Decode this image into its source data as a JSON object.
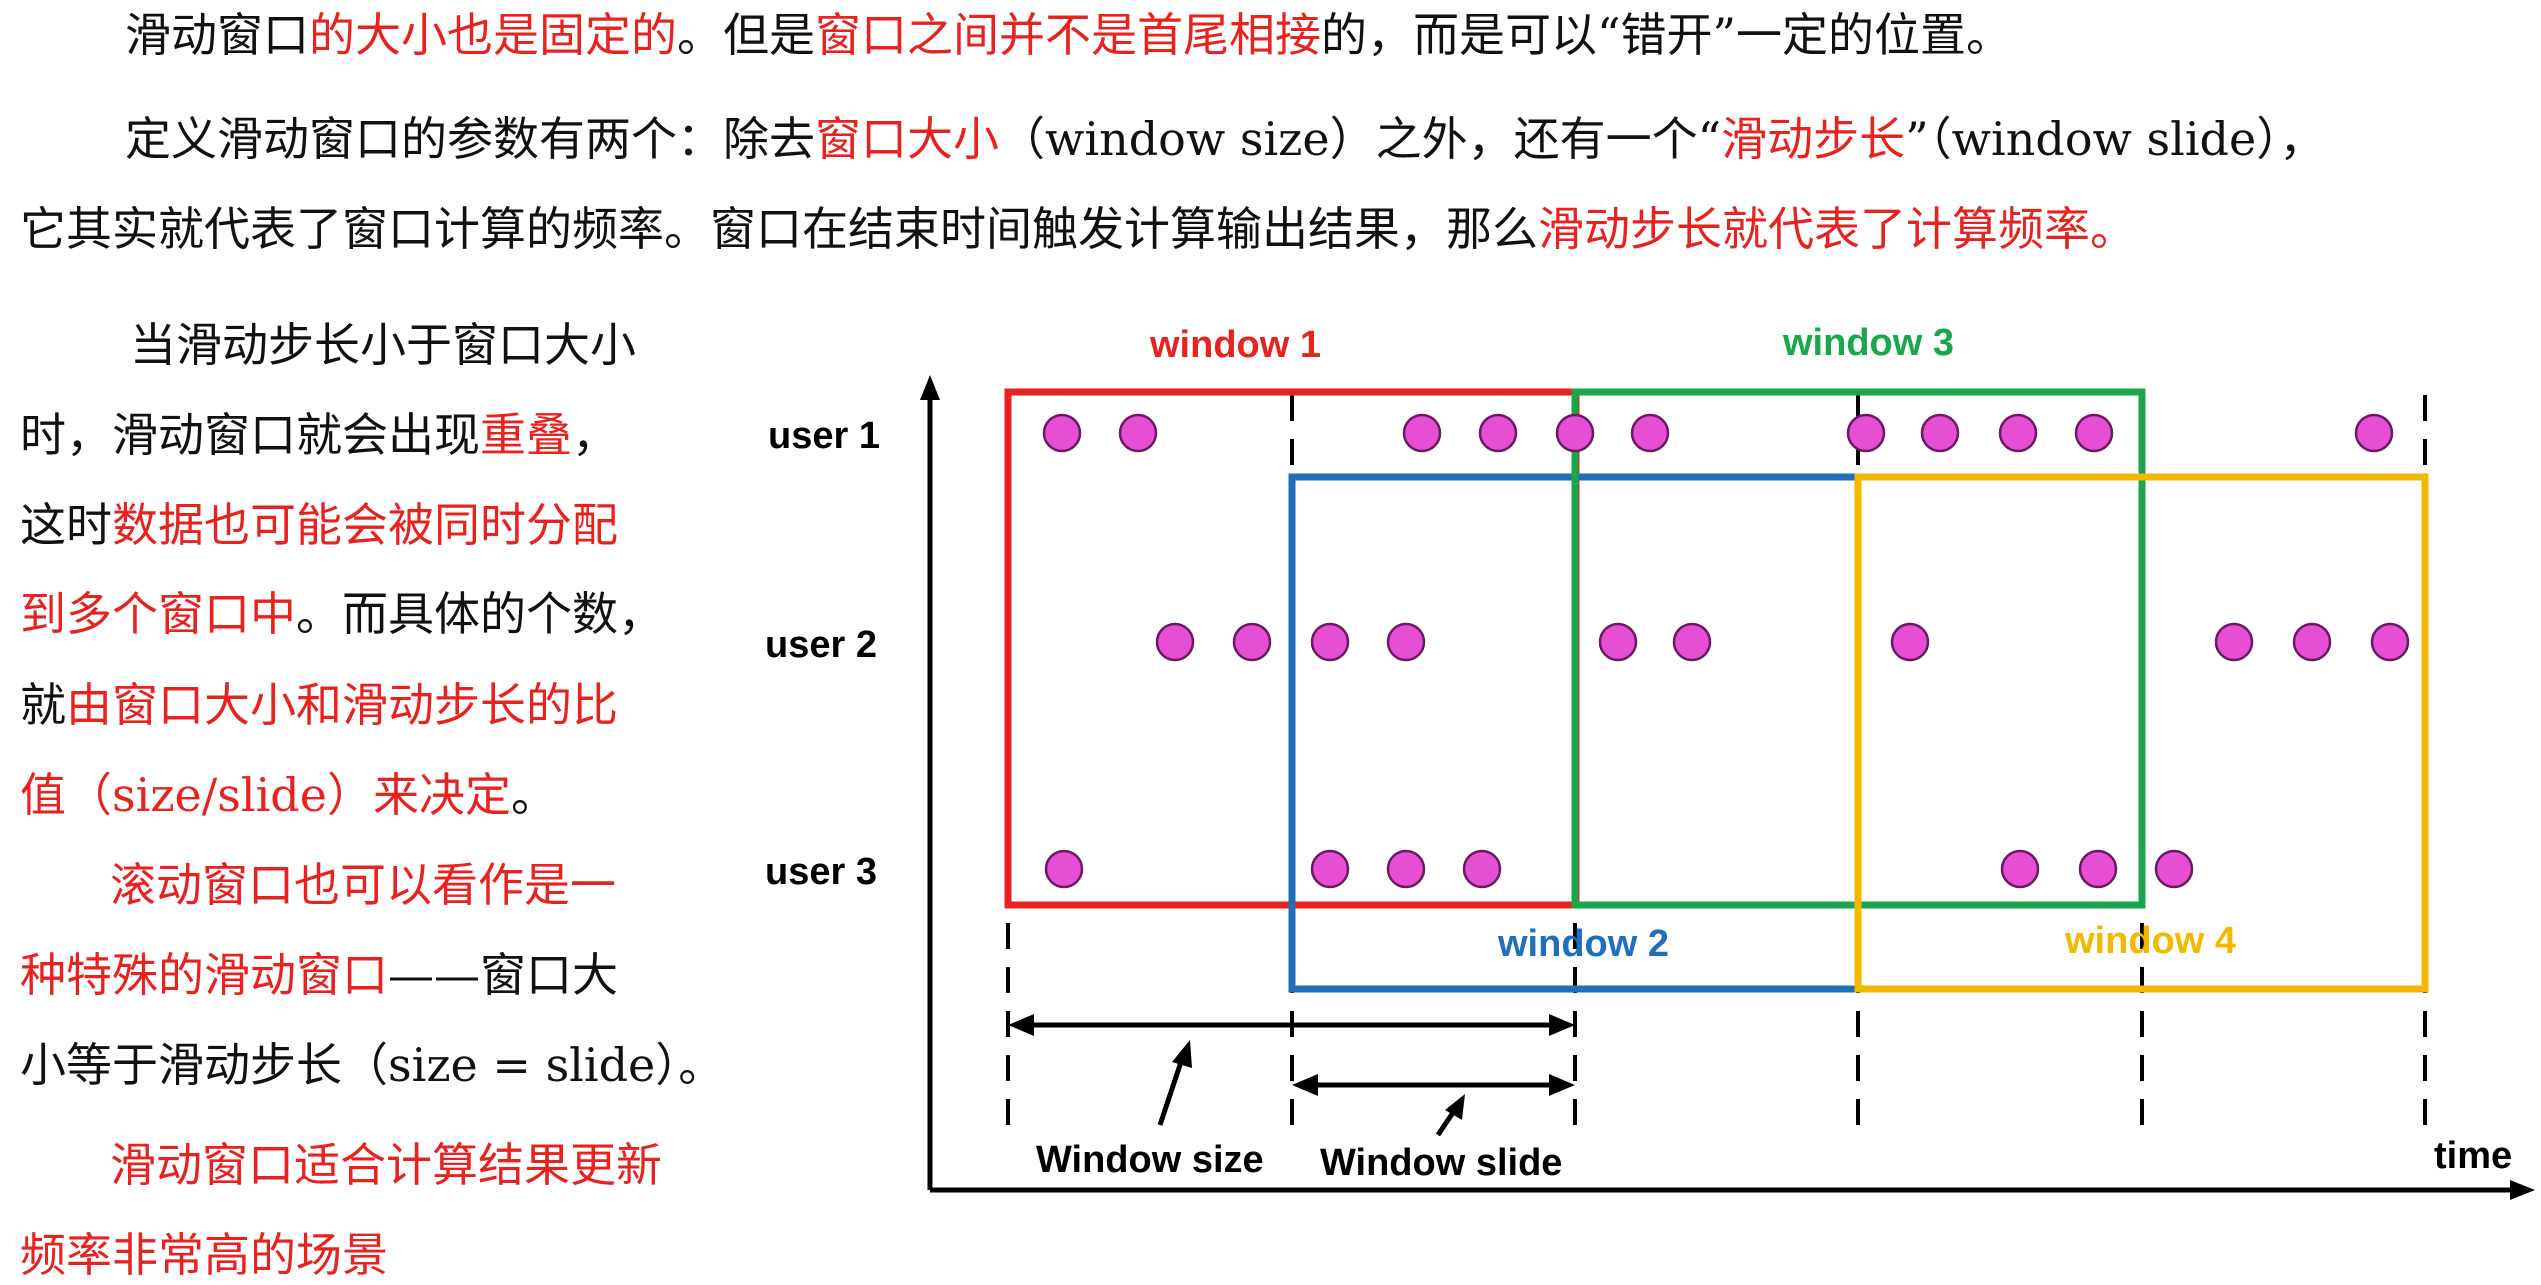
{
  "paragraph1": [
    {
      "t": "滑动窗口",
      "red": false
    },
    {
      "t": "的大小也是固定的",
      "red": true
    },
    {
      "t": "。但是",
      "red": false
    },
    {
      "t": "窗口之间并不是首尾相接",
      "red": true
    },
    {
      "t": "的，而是可以“错开”一定的位置。",
      "red": false
    }
  ],
  "paragraph2_line1": [
    {
      "t": "定义滑动窗口的参数有两个：除去",
      "red": false
    },
    {
      "t": "窗口大小",
      "red": true
    },
    {
      "t": "（window size）之外，还有一个“",
      "red": false
    },
    {
      "t": "滑动步长",
      "red": true
    },
    {
      "t": "”（window slide），",
      "red": false
    }
  ],
  "paragraph2_line2": [
    {
      "t": "它其实就代表了窗口计算的频率。窗口在结束时间触发计算输出结果，那么",
      "red": false
    },
    {
      "t": "滑动步长就代表了计算频率。",
      "red": true
    }
  ],
  "side_lines": [
    [
      {
        "t": "当滑动步长小于窗口大小",
        "red": false
      }
    ],
    [
      {
        "t": "时，滑动窗口就会出现",
        "red": false
      },
      {
        "t": "重叠",
        "red": true
      },
      {
        "t": "，",
        "red": false
      }
    ],
    [
      {
        "t": "这时",
        "red": false
      },
      {
        "t": "数据也可能会被同时分配",
        "red": true
      }
    ],
    [
      {
        "t": "到多个窗口中",
        "red": true
      },
      {
        "t": "。而具体的个数，",
        "red": false
      }
    ],
    [
      {
        "t": "就",
        "red": false
      },
      {
        "t": "由窗口大小和滑动步长的比",
        "red": true
      }
    ],
    [
      {
        "t": "值（size/slide）来决定",
        "red": true
      },
      {
        "t": "。",
        "red": false
      }
    ],
    [
      {
        "t": "滚动窗口也可以看作是一",
        "red": true
      }
    ],
    [
      {
        "t": "种特殊的滑动窗口",
        "red": true
      },
      {
        "t": "——窗口大",
        "red": false
      }
    ],
    [
      {
        "t": "小等于滑动步长（size = slide）。",
        "red": false
      }
    ],
    [
      {
        "t": "滑动窗口适合计算结果更新",
        "red": true
      }
    ],
    [
      {
        "t": "频率非常高的场景",
        "red": true
      }
    ]
  ],
  "diagram": {
    "rows": [
      "user 1",
      "user 2",
      "user 3"
    ],
    "windows": [
      {
        "label": "window 1",
        "color": "#e8231f"
      },
      {
        "label": "window 2",
        "color": "#1f6fbd"
      },
      {
        "label": "window 3",
        "color": "#1aa64a"
      },
      {
        "label": "window 4",
        "color": "#f5b800"
      }
    ],
    "size_label": "Window size",
    "slide_label": "Window slide",
    "time_label": "time",
    "dot_color": "#e64fd3"
  }
}
